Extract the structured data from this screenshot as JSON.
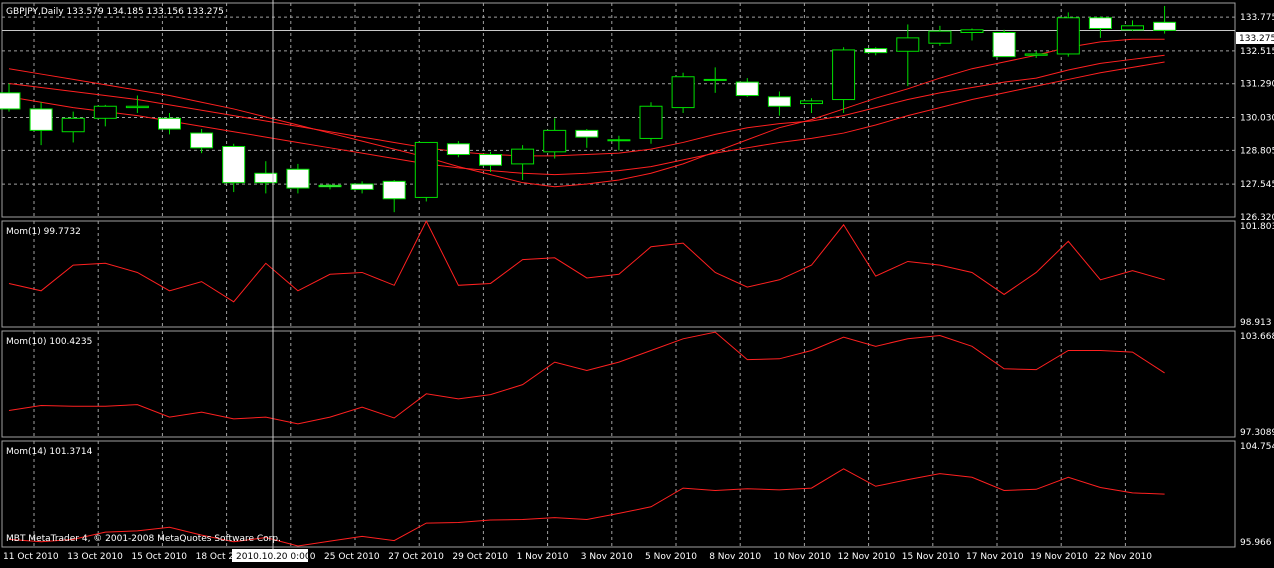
{
  "window": {
    "symbol_header": "GBPJPY,Daily  133.579 134.185 133.156 133.275",
    "watermark": "MBT MetaTrader 4, © 2001-2008 MetaQuotes Software Corp.",
    "crosshair_time_label": "2010.10.20 0:00",
    "current_price_label": "133.275"
  },
  "colors": {
    "background": "#000000",
    "grid": "#a0a0a0",
    "candle_outline": "#00e000",
    "bull_body": "#000000",
    "bear_body": "#ffffff",
    "indicator_line": "#ff2020",
    "axis_text": "#ffffff",
    "crosshair": "#c8c8c8"
  },
  "chart_data": [
    {
      "type": "candlestick",
      "title": "GBPJPY,Daily",
      "y_ticks": [
        "133.775",
        "132.515",
        "131.290",
        "130.030",
        "128.805",
        "127.545",
        "126.320"
      ],
      "ylim": [
        126.32,
        134.3
      ],
      "x_tick_labels": [
        "11 Oct 2010",
        "13 Oct 2010",
        "15 Oct 2010",
        "18 Oct 2010",
        "22 Oct 2010",
        "25 Oct 2010",
        "27 Oct 2010",
        "29 Oct 2010",
        "1 Nov 2010",
        "3 Nov 2010",
        "5 Nov 2010",
        "8 Nov 2010",
        "10 Nov 2010",
        "12 Nov 2010",
        "15 Nov 2010",
        "17 Nov 2010",
        "19 Nov 2010",
        "22 Nov 2010"
      ],
      "ohlc": [
        {
          "o": 130.95,
          "h": 131.3,
          "l": 130.25,
          "c": 130.35
        },
        {
          "o": 130.35,
          "h": 130.6,
          "l": 129.0,
          "c": 129.55
        },
        {
          "o": 129.5,
          "h": 130.25,
          "l": 129.1,
          "c": 130.0
        },
        {
          "o": 130.0,
          "h": 130.5,
          "l": 129.7,
          "c": 130.45
        },
        {
          "o": 130.4,
          "h": 130.85,
          "l": 130.2,
          "c": 130.45
        },
        {
          "o": 130.0,
          "h": 130.2,
          "l": 129.4,
          "c": 129.6
        },
        {
          "o": 129.45,
          "h": 129.6,
          "l": 128.7,
          "c": 128.9
        },
        {
          "o": 128.95,
          "h": 129.05,
          "l": 127.25,
          "c": 127.6
        },
        {
          "o": 127.95,
          "h": 128.4,
          "l": 127.2,
          "c": 127.6
        },
        {
          "o": 128.1,
          "h": 128.3,
          "l": 127.2,
          "c": 127.4
        },
        {
          "o": 127.5,
          "h": 127.55,
          "l": 127.35,
          "c": 127.45
        },
        {
          "o": 127.55,
          "h": 127.65,
          "l": 127.2,
          "c": 127.35
        },
        {
          "o": 127.65,
          "h": 127.7,
          "l": 126.5,
          "c": 127.0
        },
        {
          "o": 127.05,
          "h": 129.1,
          "l": 126.9,
          "c": 129.1
        },
        {
          "o": 129.05,
          "h": 129.15,
          "l": 128.55,
          "c": 128.65
        },
        {
          "o": 128.65,
          "h": 128.75,
          "l": 128.0,
          "c": 128.25
        },
        {
          "o": 128.3,
          "h": 129.0,
          "l": 127.7,
          "c": 128.85
        },
        {
          "o": 128.75,
          "h": 130.0,
          "l": 128.5,
          "c": 129.55
        },
        {
          "o": 129.55,
          "h": 129.6,
          "l": 128.9,
          "c": 129.3
        },
        {
          "o": 129.2,
          "h": 129.35,
          "l": 128.8,
          "c": 129.2
        },
        {
          "o": 129.25,
          "h": 130.6,
          "l": 129.05,
          "c": 130.45
        },
        {
          "o": 130.4,
          "h": 131.7,
          "l": 130.2,
          "c": 131.55
        },
        {
          "o": 131.45,
          "h": 131.9,
          "l": 130.95,
          "c": 131.45
        },
        {
          "o": 131.35,
          "h": 131.5,
          "l": 130.8,
          "c": 130.85
        },
        {
          "o": 130.8,
          "h": 131.0,
          "l": 130.1,
          "c": 130.45
        },
        {
          "o": 130.55,
          "h": 130.75,
          "l": 130.2,
          "c": 130.65
        },
        {
          "o": 130.7,
          "h": 132.65,
          "l": 130.2,
          "c": 132.55
        },
        {
          "o": 132.6,
          "h": 132.65,
          "l": 132.35,
          "c": 132.45
        },
        {
          "o": 132.5,
          "h": 133.5,
          "l": 131.2,
          "c": 133.0
        },
        {
          "o": 132.8,
          "h": 133.45,
          "l": 132.7,
          "c": 133.25
        },
        {
          "o": 133.2,
          "h": 133.35,
          "l": 132.9,
          "c": 133.3
        },
        {
          "o": 133.2,
          "h": 133.3,
          "l": 132.35,
          "c": 132.3
        },
        {
          "o": 132.35,
          "h": 132.5,
          "l": 132.25,
          "c": 132.4
        },
        {
          "o": 132.4,
          "h": 133.95,
          "l": 132.3,
          "c": 133.75
        },
        {
          "o": 133.75,
          "h": 133.8,
          "l": 133.0,
          "c": 133.35
        },
        {
          "o": 133.3,
          "h": 133.65,
          "l": 133.25,
          "c": 133.45
        },
        {
          "o": 133.58,
          "h": 134.19,
          "l": 133.16,
          "c": 133.28
        }
      ],
      "overlay_lines": [
        {
          "values": [
            131.3,
            131.15,
            131.0,
            130.85,
            130.7,
            130.5,
            130.3,
            130.1,
            129.9,
            129.7,
            129.5,
            129.3,
            129.1,
            128.9,
            128.75,
            128.65,
            128.6,
            128.6,
            128.65,
            128.7,
            128.85,
            129.1,
            129.4,
            129.65,
            129.8,
            129.9,
            130.1,
            130.4,
            130.7,
            130.95,
            131.15,
            131.35,
            131.5,
            131.8,
            132.05,
            132.2,
            132.35
          ]
        },
        {
          "values": [
            130.8,
            130.6,
            130.4,
            130.25,
            130.1,
            129.9,
            129.7,
            129.5,
            129.3,
            129.1,
            128.9,
            128.7,
            128.5,
            128.3,
            128.15,
            128.05,
            127.95,
            127.9,
            127.95,
            128.05,
            128.2,
            128.45,
            128.7,
            128.9,
            129.1,
            129.25,
            129.45,
            129.75,
            130.1,
            130.4,
            130.7,
            130.95,
            131.2,
            131.45,
            131.7,
            131.9,
            132.1
          ]
        },
        {
          "values": [
            131.85,
            131.65,
            131.45,
            131.25,
            131.05,
            130.85,
            130.6,
            130.35,
            130.05,
            129.75,
            129.45,
            129.15,
            128.85,
            128.55,
            128.2,
            127.9,
            127.6,
            127.45,
            127.55,
            127.7,
            127.95,
            128.3,
            128.75,
            129.2,
            129.65,
            129.95,
            130.35,
            130.75,
            131.1,
            131.5,
            131.85,
            132.1,
            132.35,
            132.65,
            132.85,
            132.95,
            132.95
          ]
        }
      ]
    },
    {
      "type": "line",
      "title": "Mom(1) 99.7732",
      "y_ticks": [
        "101.803",
        "98.913"
      ],
      "ylim": [
        98.913,
        101.803
      ],
      "series": [
        {
          "values": [
            100.1,
            99.9,
            100.6,
            100.65,
            100.4,
            99.9,
            100.15,
            99.6,
            100.65,
            99.9,
            100.35,
            100.4,
            100.05,
            101.8,
            100.05,
            100.1,
            100.75,
            100.8,
            100.25,
            100.35,
            101.1,
            101.2,
            100.4,
            100.0,
            100.2,
            100.6,
            101.7,
            100.3,
            100.7,
            100.6,
            100.4,
            99.8,
            100.4,
            101.25,
            100.2,
            100.45,
            100.2
          ]
        }
      ]
    },
    {
      "type": "line",
      "title": "Mom(10) 100.4235",
      "y_ticks": [
        "103.668",
        "97.3089"
      ],
      "ylim": [
        97.3089,
        103.668
      ],
      "series": [
        {
          "values": [
            98.9,
            99.2,
            99.15,
            99.15,
            99.25,
            98.5,
            98.8,
            98.4,
            98.5,
            98.1,
            98.5,
            99.1,
            98.45,
            99.9,
            99.6,
            99.85,
            100.45,
            101.8,
            101.3,
            101.8,
            102.5,
            103.2,
            103.6,
            101.95,
            102.0,
            102.5,
            103.3,
            102.75,
            103.2,
            103.4,
            102.75,
            101.4,
            101.35,
            102.5,
            102.5,
            102.4,
            101.15
          ]
        }
      ]
    },
    {
      "type": "line",
      "title": "Mom(14) 101.3714",
      "y_ticks": [
        "104.754",
        "95.966"
      ],
      "ylim": [
        95.966,
        104.754
      ],
      "series": [
        {
          "values": [
            96.6,
            96.4,
            96.6,
            97.2,
            97.3,
            97.6,
            96.95,
            96.4,
            96.75,
            96.05,
            96.45,
            96.85,
            96.5,
            97.95,
            98.0,
            98.2,
            98.25,
            98.4,
            98.25,
            98.75,
            99.3,
            100.85,
            100.65,
            100.8,
            100.7,
            100.85,
            102.45,
            101.0,
            101.55,
            102.05,
            101.75,
            100.65,
            100.75,
            101.75,
            100.9,
            100.45,
            100.35
          ]
        }
      ]
    }
  ]
}
